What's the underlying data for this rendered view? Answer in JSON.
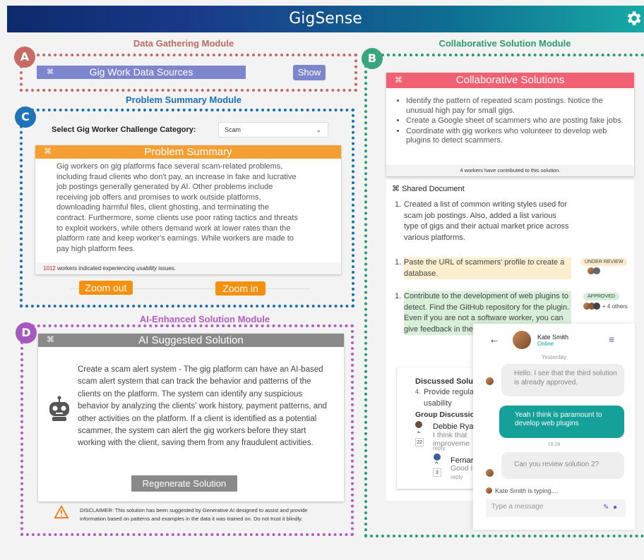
{
  "app": {
    "title": "GigSense"
  },
  "modules": {
    "data_gathering": {
      "title": "Data Gathering Module",
      "badge": "A",
      "bar_label": "Gig Work Data Sources",
      "show_label": "Show"
    },
    "problem_summary": {
      "title": "Problem Summary Module",
      "badge": "C",
      "select_label": "Select Gig Worker Challenge Category:",
      "select_value": "Scam",
      "card_title": "Problem Summary",
      "text": "Gig workers on gig platforms face several scam-related problems, including fraud clients who don't pay, an increase in fake and lucrative job postings generally generated by AI. Other problems include receiving job offers and promises to work outside platforms, downloading harmful files, client ghosting, and terminating the contract. Furthermore, some clients use poor rating tactics and threats to exploit workers, while others demand work at lower rates than the platform rate and keep worker's earnings. While workers are made to pay high platform fees.",
      "footer_count": "1012",
      "footer_text_a": " workers indicated experiencing ",
      "footer_em": "usability",
      "footer_text_b": " issues.",
      "zoom_out": "Zoom out",
      "zoom_in": "Zoom in"
    },
    "ai_solution": {
      "title": "AI-Enhanced Solution Module",
      "badge": "D",
      "card_title": "AI Suggested Solution",
      "text": "Create a scam alert system - The gig platform can have an AI-based scam alert system that can track the behavior and patterns of the clients on the platform. The system can identify any suspicious behavior by analyzing the clients' work history, payment patterns, and other activities on the platform. If a client is identified as a potential scammer, the system can alert the gig workers before they start working with the client, saving them from any fraudulent activities.",
      "regen": "Regenerate Solution",
      "disclaimer": "DISCLAIMER: This solution has been suggested by Generative AI designed to assist and provide information based on patterns and examples in the data it was trained on. Do not trust it blindly."
    },
    "collab": {
      "title": "Collaborative Solution Module",
      "badge": "B",
      "card_title": "Collaborative Solutions",
      "bullets": [
        "Identify the pattern of repeated scam postings. Notice the unusual high pay for small gigs.",
        "Create a Google sheet of scammers who are posting fake jobs.",
        "Coordinate with gig workers who volunteer to develop web plugins to detect scammers."
      ],
      "contrib": "4 workers have contributed to this solution.",
      "doc_title": "Shared Document",
      "doc_items": [
        {
          "num": "1.",
          "text": "Created a list of common writing styles used for scam job postings. Also, added a list various type of gigs and their actual market price across various platforms."
        },
        {
          "num": "1.",
          "text": "Paste the URL of scammers' profile to create a database.",
          "status": "UNDER REVIEW"
        },
        {
          "num": "1.",
          "text": "Contribute to the development of web plugins to detect. Find the GitHub repository for the plugin. Even if you are not a software worker, you can give feedback in the plugin.",
          "status": "APPROVED",
          "others": "+ 4 others"
        }
      ],
      "discussed_label": "Discussed Solut",
      "disc_num": "4.",
      "disc_text": "Provide regula",
      "disc_text2": "usability",
      "group_label": "Group Discussion",
      "comments": [
        {
          "name": "Debbie Rya",
          "text": "I think that",
          "text2": "improveme",
          "reply": "reply",
          "votes": "22"
        },
        {
          "name": "Fernar",
          "text": "Good i",
          "reply": "reply",
          "votes": "3"
        }
      ]
    }
  },
  "chat": {
    "name": "Kate Smith",
    "status": "Online",
    "day": "Yesterday",
    "messages": [
      {
        "from": "them",
        "text": "Hello. I see that the third solution is already approved."
      },
      {
        "from": "me",
        "text": "Yeah  I think is paramount to develop web plugins"
      },
      {
        "from": "them",
        "text": "Can you review solution 2?"
      }
    ],
    "time": "18:28",
    "typing": "Kate Smith is typing....",
    "placeholder": "Type a message"
  }
}
